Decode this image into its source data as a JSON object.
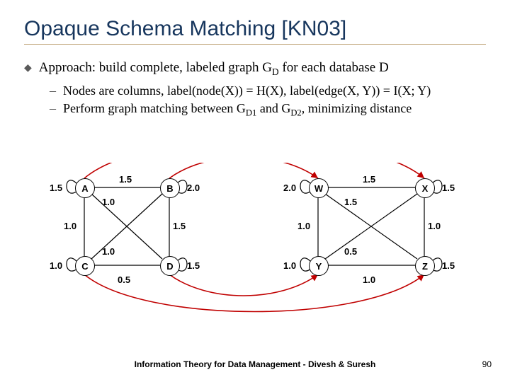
{
  "title": "Opaque Schema Matching [KN03]",
  "bullets": {
    "main": "Approach: build complete, labeled graph G",
    "main_sub": "D",
    "main_tail": " for each database D",
    "s1": "Nodes are columns, label(node(X)) = H(X), label(edge(X, Y)) = I(X; Y)",
    "s2a": "Perform graph matching between G",
    "s2a_sub": "D1",
    "s2b": " and G",
    "s2b_sub": "D2",
    "s2c": ", minimizing distance"
  },
  "nodes": {
    "A": "A",
    "B": "B",
    "C": "C",
    "D": "D",
    "W": "W",
    "X": "X",
    "Y": "Y",
    "Z": "Z"
  },
  "labels": {
    "l15a": "1.5",
    "l15b": "1.5",
    "l15c": "1.5",
    "l15d": "1.5",
    "l15e": "1.5",
    "l15f": "1.5",
    "l15g": "1.5",
    "l15h": "1.5",
    "l10a": "1.0",
    "l10b": "1.0",
    "l10c": "1.0",
    "l10d": "1.0",
    "l10e": "1.0",
    "l10f": "1.0",
    "l10g": "1.0",
    "l10h": "1.0",
    "l20a": "2.0",
    "l20b": "2.0",
    "l05a": "0.5",
    "l05b": "0.5"
  },
  "footer": "Information Theory for Data Management - Divesh & Suresh",
  "page": "90"
}
